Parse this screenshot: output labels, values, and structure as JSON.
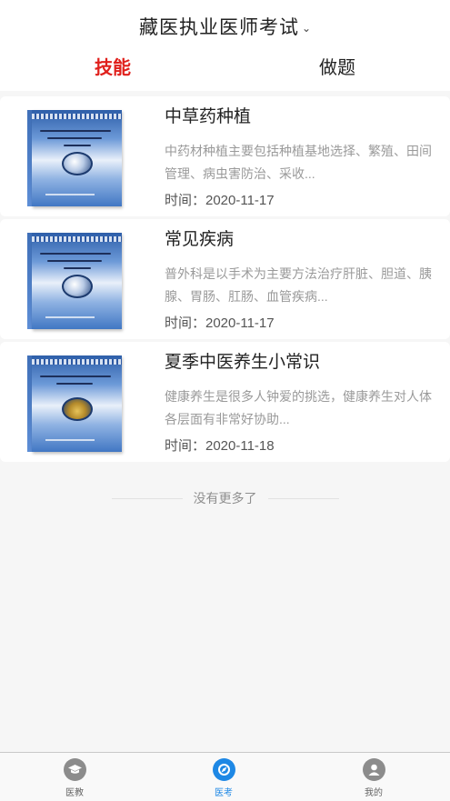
{
  "header": {
    "title": "藏医执业医师考试",
    "chevron_icon": "chevron-down-icon",
    "tabs": [
      {
        "label": "技能",
        "active": true
      },
      {
        "label": "做题",
        "active": false
      }
    ]
  },
  "articles": [
    {
      "title": "中草药种植",
      "description": "中药材种植主要包括种植基地选择、繁殖、田间管理、病虫害防治、采收...",
      "date": "时间：2020-11-17",
      "thumbnail_icon": "book-cover-icon"
    },
    {
      "title": "常见疾病",
      "description": "普外科是以手术为主要方法治疗肝脏、胆道、胰腺、胃肠、肛肠、血管疾病...",
      "date": "时间：2020-11-17",
      "thumbnail_icon": "book-cover-icon"
    },
    {
      "title": "夏季中医养生小常识",
      "description": "健康养生是很多人钟爱的挑选，健康养生对人体各层面有非常好协助...",
      "date": "时间：2020-11-18",
      "thumbnail_icon": "book-cover-icon"
    }
  ],
  "list_footer": "没有更多了",
  "bottom_nav": [
    {
      "label": "医教",
      "icon": "graduation-cap-icon",
      "active": false
    },
    {
      "label": "医考",
      "icon": "compass-icon",
      "active": true
    },
    {
      "label": "我的",
      "icon": "user-icon",
      "active": false
    }
  ],
  "colors": {
    "accent_red": "#e0201c",
    "accent_blue": "#1e88e5",
    "background": "#f6f6f6"
  }
}
